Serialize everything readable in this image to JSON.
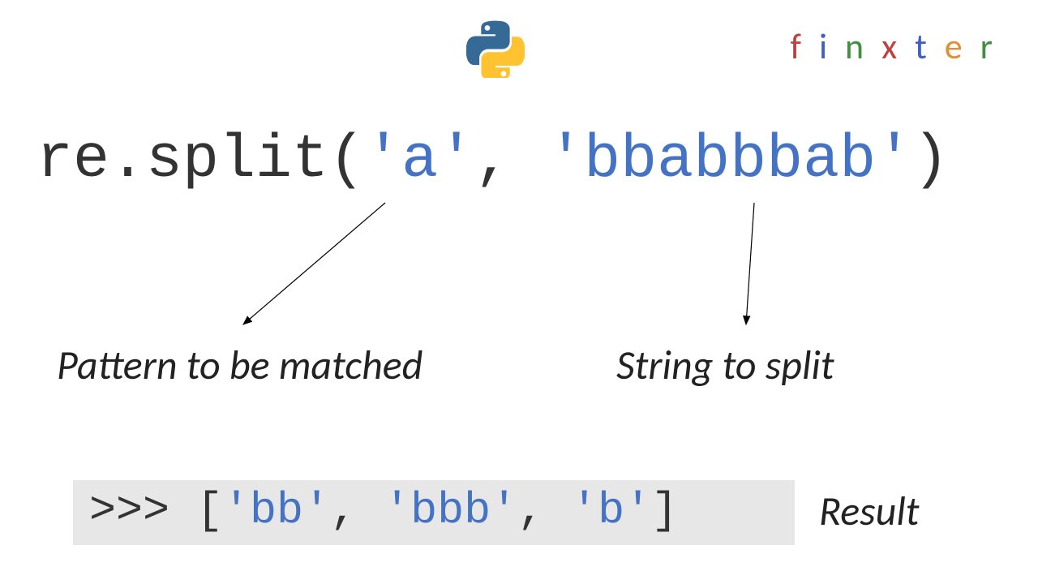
{
  "brand": {
    "letters": [
      "f",
      "i",
      "n",
      "x",
      "t",
      "e",
      "r"
    ]
  },
  "code": {
    "prefix": "re.split(",
    "arg1": "'a'",
    "sep": ", ",
    "arg2": "'bbabbbab'",
    "suffix": ")"
  },
  "labels": {
    "pattern": "Pattern to be matched",
    "string": "String to split",
    "result": "Result"
  },
  "result": {
    "prompt": ">>> ",
    "open": "[",
    "item1": "'bb'",
    "c1": ", ",
    "item2": "'bbb'",
    "c2": ", ",
    "item3": "'b'",
    "close": "]"
  }
}
